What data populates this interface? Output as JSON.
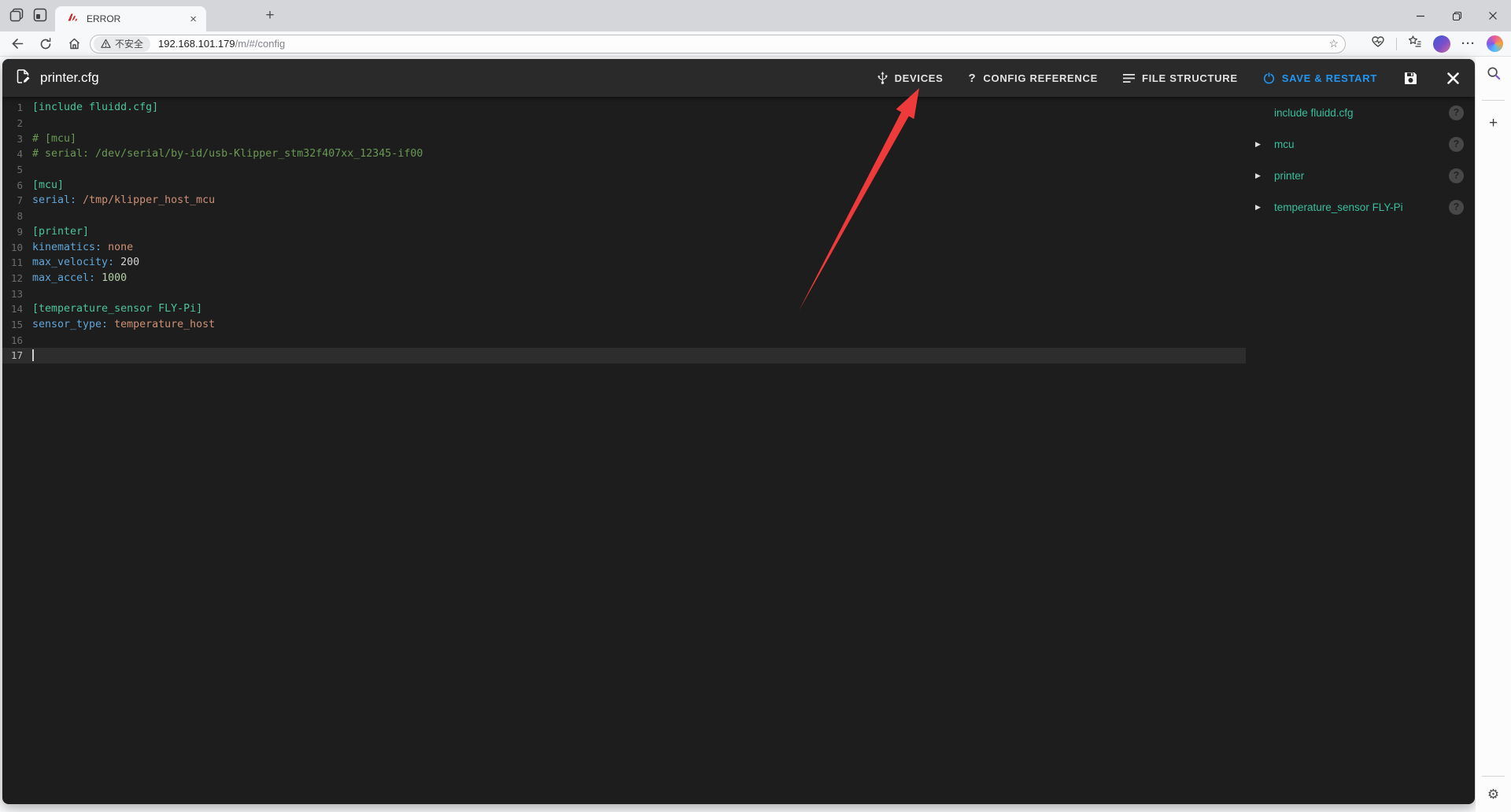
{
  "browser": {
    "tab_title": "ERROR",
    "security_label": "不安全",
    "url_host": "192.168.101.179",
    "url_path": "/m/#/config"
  },
  "dialog": {
    "title": "printer.cfg",
    "buttons": {
      "devices": "DEVICES",
      "config_reference": "CONFIG REFERENCE",
      "file_structure": "FILE STRUCTURE",
      "save_restart": "SAVE & RESTART"
    }
  },
  "editor": {
    "current_line": 17,
    "lines": [
      {
        "n": 1,
        "tokens": [
          {
            "t": "[include fluidd.cfg]",
            "c": "section"
          }
        ]
      },
      {
        "n": 2,
        "tokens": []
      },
      {
        "n": 3,
        "tokens": [
          {
            "t": "# [mcu]",
            "c": "comment"
          }
        ]
      },
      {
        "n": 4,
        "tokens": [
          {
            "t": "# serial: /dev/serial/by-id/usb-Klipper_stm32f407xx_12345-if00",
            "c": "comment"
          }
        ]
      },
      {
        "n": 5,
        "tokens": []
      },
      {
        "n": 6,
        "tokens": [
          {
            "t": "[mcu]",
            "c": "section"
          }
        ]
      },
      {
        "n": 7,
        "tokens": [
          {
            "t": "serial:",
            "c": "key"
          },
          {
            "t": " ",
            "c": "plain"
          },
          {
            "t": "/tmp/klipper_host_mcu",
            "c": "value"
          }
        ]
      },
      {
        "n": 8,
        "tokens": []
      },
      {
        "n": 9,
        "tokens": [
          {
            "t": "[printer]",
            "c": "section"
          }
        ]
      },
      {
        "n": 10,
        "tokens": [
          {
            "t": "kinematics:",
            "c": "key"
          },
          {
            "t": " ",
            "c": "plain"
          },
          {
            "t": "none",
            "c": "value"
          }
        ]
      },
      {
        "n": 11,
        "tokens": [
          {
            "t": "max_velocity:",
            "c": "key"
          },
          {
            "t": " ",
            "c": "plain"
          },
          {
            "t": "200",
            "c": "num"
          }
        ]
      },
      {
        "n": 12,
        "tokens": [
          {
            "t": "max_accel:",
            "c": "key"
          },
          {
            "t": " ",
            "c": "plain"
          },
          {
            "t": "1000",
            "c": "num2"
          }
        ]
      },
      {
        "n": 13,
        "tokens": []
      },
      {
        "n": 14,
        "tokens": [
          {
            "t": "[temperature_sensor FLY-Pi]",
            "c": "section"
          }
        ]
      },
      {
        "n": 15,
        "tokens": [
          {
            "t": "sensor_type:",
            "c": "key"
          },
          {
            "t": " ",
            "c": "plain"
          },
          {
            "t": "temperature_host",
            "c": "value"
          }
        ]
      },
      {
        "n": 16,
        "tokens": []
      },
      {
        "n": 17,
        "tokens": []
      }
    ]
  },
  "file_sidebar": {
    "items": [
      {
        "label": "include fluidd.cfg",
        "expandable": false
      },
      {
        "label": "mcu",
        "expandable": true
      },
      {
        "label": "printer",
        "expandable": true
      },
      {
        "label": "temperature_sensor FLY-Pi",
        "expandable": true
      }
    ]
  },
  "glyphs": {
    "new_tab": "+",
    "tab_close": "×",
    "favorite_star": "☆",
    "ellipsis": "···",
    "question_mark": "?",
    "expand_arrow": "▶",
    "help": "?",
    "sidebar_plus": "+",
    "gear": "⚙"
  },
  "colors": {
    "panel_bg": "#1d1d1d",
    "topbar_bg": "#2a2a2a",
    "current_line": "#2d2d2d",
    "section": "#4dc49a",
    "comment": "#6a9955",
    "key": "#61a6d9",
    "value": "#cd9077",
    "number": "#d4d4d4",
    "number_alt": "#b5cea8",
    "plain": "#d4d4d4",
    "sidebar_teal": "#38bf9c",
    "save_blue": "#2196f3",
    "arrow_red": "#ee3a3a"
  }
}
